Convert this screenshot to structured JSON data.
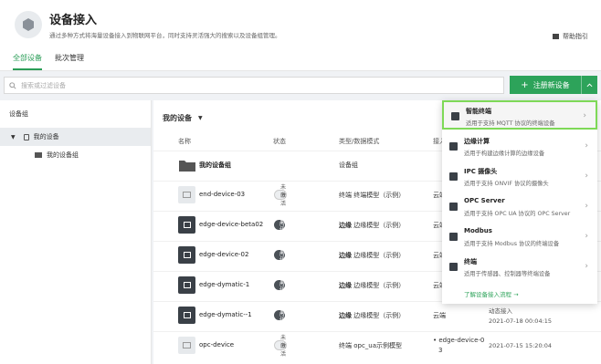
{
  "header": {
    "title": "设备接入",
    "subtitle": "通过多种方式将海量设备接入到物联网平台，同时支持灵活强大的搜索以及设备组管理。",
    "help": "帮助指引",
    "tabs": [
      "全部设备",
      "批次管理"
    ]
  },
  "toolbar": {
    "search_placeholder": "搜索或过滤设备",
    "register_label": "注册新设备"
  },
  "sidebar": {
    "title": "设备组",
    "items": [
      "我的设备",
      "我的设备组"
    ]
  },
  "main": {
    "title": "我的设备",
    "columns": [
      "名称",
      "状态",
      "类型/数据模式",
      "接入"
    ],
    "rows": [
      {
        "name": "我的设备组",
        "status": "",
        "type_bold": "",
        "type": "设备组",
        "col5": "",
        "col6": ""
      },
      {
        "name": "end-device-03",
        "status": "未激活",
        "type_bold": "",
        "type": "终端  终端模型（示例）",
        "col5": "云端",
        "col6": ""
      },
      {
        "name": "edge-device-beta02",
        "status": "离线",
        "type_bold": "边缘",
        "type": "边缘模型（示例）",
        "col5": "云端",
        "col6": ""
      },
      {
        "name": "edge-device-02",
        "status": "离线",
        "type_bold": "边缘",
        "type": "边缘模型（示例）",
        "col5": "云端",
        "col6": ""
      },
      {
        "name": "edge-dymatic-1",
        "status": "离线",
        "type_bold": "边缘",
        "type": "边缘模型（示例）",
        "col5": "云端",
        "col6": ""
      },
      {
        "name": "edge-dymatic--1",
        "status": "离线",
        "type_bold": "边缘",
        "type": "边缘模型（示例）",
        "col5": "云端",
        "col6": "动态接入",
        "col6b": "2021-07-18 00:04:15"
      },
      {
        "name": "opc-device",
        "status": "未激活",
        "type_bold": "",
        "type": "终端  opc_ua示例模型",
        "col5": "edge-device-0",
        "col5b": "3",
        "col6": "2021-07-15 15:20:04"
      }
    ]
  },
  "dropdown": {
    "items": [
      {
        "name": "智能终端",
        "desc": "适用于支持 MQTT 协议的终端设备"
      },
      {
        "name": "边缘计算",
        "desc": "适用于构建边缘计算的边缘设备"
      },
      {
        "name": "IPC 摄像头",
        "desc": "适用于支持 ONVIF 协议的摄像头"
      },
      {
        "name": "OPC Server",
        "desc": "适用于支持 OPC UA 协议的 OPC Server"
      },
      {
        "name": "Modbus",
        "desc": "适用于支持 Modbus 协议的终端设备"
      },
      {
        "name": "终端",
        "desc": "适用于传感器、控制器等终端设备"
      }
    ],
    "link": "了解设备接入流程 →"
  },
  "colors": {
    "accent": "#2da35a",
    "highlight": "#7ed957"
  }
}
